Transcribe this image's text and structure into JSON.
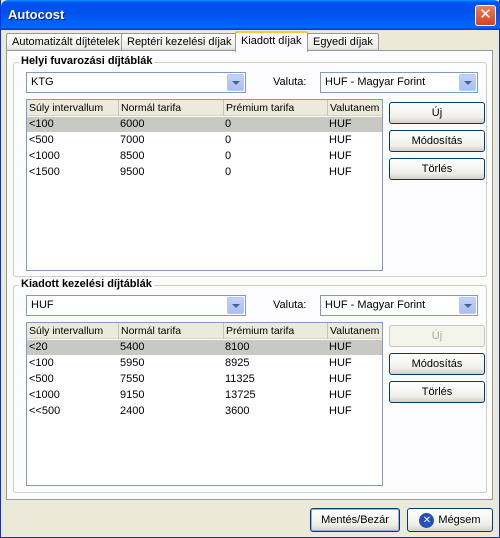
{
  "window": {
    "title": "Autocost",
    "close_glyph": "✕"
  },
  "tabs": [
    {
      "label": "Automatizált díjtételek"
    },
    {
      "label": "Reptéri kezelési díjak"
    },
    {
      "label": "Kiadott díjak"
    },
    {
      "label": "Egyedi díjak"
    }
  ],
  "active_tab": "Kiadott díjak",
  "group1": {
    "title": "Helyi fuvarozási díjtáblák",
    "combo_value": "KTG",
    "currency_label": "Valuta:",
    "currency_value": "HUF - Magyar Forint",
    "columns": [
      "Súly intervallum",
      "Normál tarifa",
      "Prémium tarifa",
      "Valutanem"
    ],
    "rows": [
      [
        "<100",
        "6000",
        "0",
        "HUF"
      ],
      [
        "<500",
        "7000",
        "0",
        "HUF"
      ],
      [
        "<1000",
        "8500",
        "0",
        "HUF"
      ],
      [
        "<1500",
        "9500",
        "0",
        "HUF"
      ]
    ],
    "selected_row": 0,
    "buttons": {
      "new": "Új",
      "modify": "Módosítás",
      "delete": "Törlés"
    }
  },
  "group2": {
    "title": "Kiadott kezelési díjtáblák",
    "combo_value": "HUF",
    "currency_label": "Valuta:",
    "currency_value": "HUF - Magyar Forint",
    "columns": [
      "Súly intervallum",
      "Normál tarifa",
      "Prémium tarifa",
      "Valutanem"
    ],
    "rows": [
      [
        "<20",
        "5400",
        "8100",
        "HUF"
      ],
      [
        "<100",
        "5950",
        "8925",
        "HUF"
      ],
      [
        "<500",
        "7550",
        "11325",
        "HUF"
      ],
      [
        "<1000",
        "9150",
        "13725",
        "HUF"
      ],
      [
        "<<500",
        "2400",
        "3600",
        "HUF"
      ]
    ],
    "selected_row": 0,
    "buttons": {
      "new": "Új",
      "modify": "Módosítás",
      "delete": "Törlés"
    }
  },
  "footer": {
    "save_label": "Mentés/Bezár",
    "cancel_label": "Mégsem",
    "cancel_icon": "✕"
  }
}
